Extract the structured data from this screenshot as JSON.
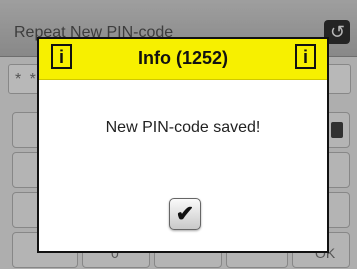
{
  "background": {
    "title": "Repeat New PIN-code",
    "back_icon": "back-arrow-icon",
    "pin_field_value": "* *",
    "keypad": {
      "bottom_left_label": "0",
      "bottom_right_label": "OK"
    }
  },
  "dialog": {
    "title": "Info (1252)",
    "icon_left": "info-icon",
    "icon_right": "info-icon",
    "icon_glyph": "i",
    "message": "New PIN-code saved!",
    "ok_icon": "checkmark-icon",
    "header_color": "#f7f000"
  }
}
